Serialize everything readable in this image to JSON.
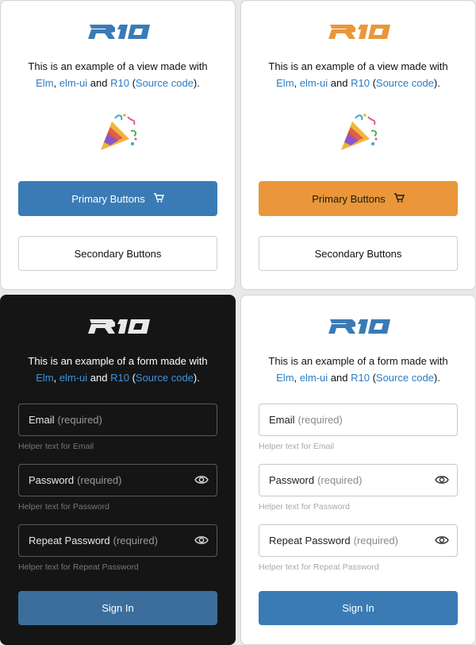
{
  "colors": {
    "brand_blue": "#3a7bb5",
    "brand_orange": "#e9973a",
    "link": "#2b7cc6",
    "dark_bg": "#151515"
  },
  "logo_text": "R10",
  "view_cards": [
    {
      "theme": "light-blue",
      "description": {
        "line1": "This is an example of a view made with",
        "link_elm": "Elm",
        "sep1": ", ",
        "link_elmui": "elm-ui",
        "and": " and ",
        "link_r10": "R10",
        "open_paren": " (",
        "link_source": "Source code",
        "close": ")."
      },
      "illustration_icon": "party-popper-icon",
      "primary_button": {
        "label": "Primary Buttons",
        "icon": "cart-icon"
      },
      "secondary_button": {
        "label": "Secondary Buttons"
      }
    },
    {
      "theme": "light-orange",
      "description": {
        "line1": "This is an example of a view made with",
        "link_elm": "Elm",
        "sep1": ", ",
        "link_elmui": "elm-ui",
        "and": " and ",
        "link_r10": "R10",
        "open_paren": " (",
        "link_source": "Source code",
        "close": ")."
      },
      "illustration_icon": "party-popper-icon",
      "primary_button": {
        "label": "Primary Buttons",
        "icon": "cart-icon"
      },
      "secondary_button": {
        "label": "Secondary Buttons"
      }
    }
  ],
  "form_cards": [
    {
      "theme": "dark",
      "description": {
        "line1": "This is an example of a form made with",
        "link_elm": "Elm",
        "sep1": ", ",
        "link_elmui": "elm-ui",
        "and": " and ",
        "link_r10": "R10",
        "open_paren": " (",
        "link_source": "Source code",
        "close": ")."
      },
      "fields": [
        {
          "label": "Email",
          "required": "(required)",
          "helper": "Helper text for Email",
          "has_eye": false
        },
        {
          "label": "Password",
          "required": "(required)",
          "helper": "Helper text for Password",
          "has_eye": true
        },
        {
          "label": "Repeat Password",
          "required": "(required)",
          "helper": "Helper text for Repeat Password",
          "has_eye": true
        }
      ],
      "submit_label": "Sign In"
    },
    {
      "theme": "light",
      "description": {
        "line1": "This is an example of a form made with",
        "link_elm": "Elm",
        "sep1": ", ",
        "link_elmui": "elm-ui",
        "and": " and ",
        "link_r10": "R10",
        "open_paren": " (",
        "link_source": "Source code",
        "close": ")."
      },
      "fields": [
        {
          "label": "Email",
          "required": "(required)",
          "helper": "Helper text for Email",
          "has_eye": false
        },
        {
          "label": "Password",
          "required": "(required)",
          "helper": "Helper text for Password",
          "has_eye": true
        },
        {
          "label": "Repeat Password",
          "required": "(required)",
          "helper": "Helper text for Repeat Password",
          "has_eye": true
        }
      ],
      "submit_label": "Sign In"
    }
  ]
}
